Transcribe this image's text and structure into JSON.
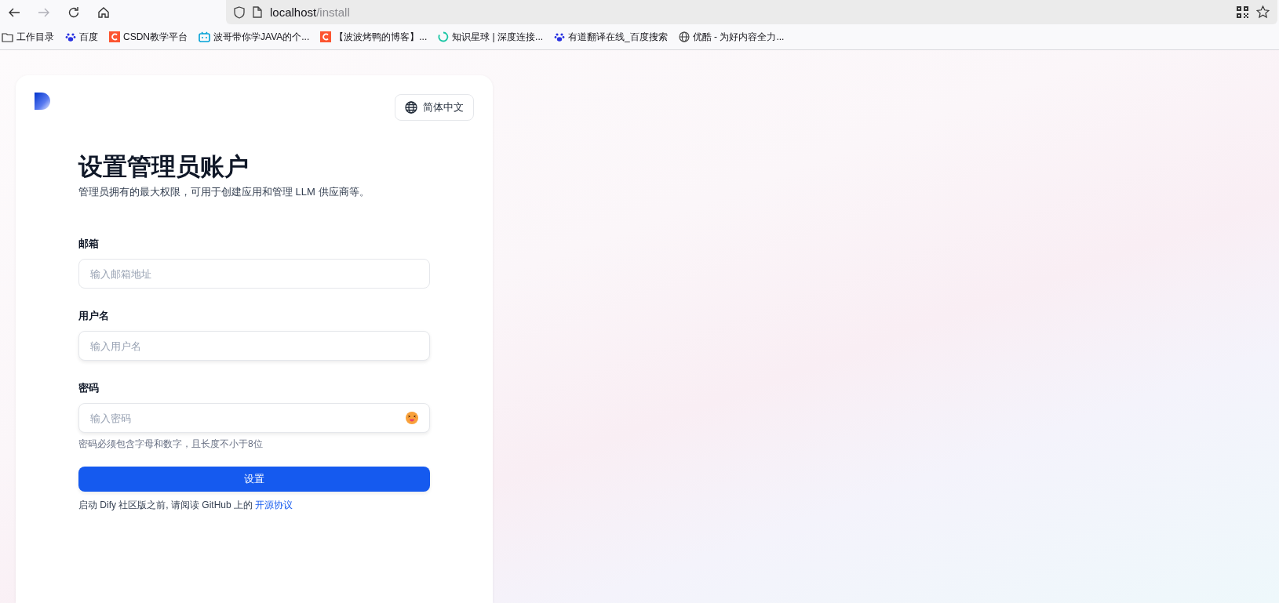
{
  "browser": {
    "address_host": "localhost",
    "address_path": "/install",
    "bookmarks": [
      {
        "kind": "folder",
        "label": "工作目录"
      },
      {
        "kind": "paw",
        "label": "百度"
      },
      {
        "kind": "csdn",
        "label": "CSDN教学平台"
      },
      {
        "kind": "tv",
        "label": "波哥带你学JAVA的个..."
      },
      {
        "kind": "csdn",
        "label": "【波波烤鸭的博客】..."
      },
      {
        "kind": "ring",
        "label": "知识星球 | 深度连接..."
      },
      {
        "kind": "paw",
        "label": "有道翻译在线_百度搜索"
      },
      {
        "kind": "globe",
        "label": "优酷 - 为好内容全力..."
      }
    ]
  },
  "card": {
    "language": "简体中文",
    "title": "设置管理员账户",
    "subtitle": "管理员拥有的最大权限，可用于创建应用和管理 LLM 供应商等。",
    "fields": [
      {
        "label": "邮箱",
        "placeholder": "输入邮箱地址",
        "kind": "text"
      },
      {
        "label": "用户名",
        "placeholder": "输入用户名",
        "kind": "text"
      },
      {
        "label": "密码",
        "placeholder": "输入密码",
        "kind": "password",
        "hint": "密码必须包含字母和数字，且长度不小于8位"
      }
    ],
    "submit": "设置",
    "footer_text": "启动 Dify 社区版之前, 请阅读 GitHub 上的 ",
    "footer_link": "开源协议"
  }
}
